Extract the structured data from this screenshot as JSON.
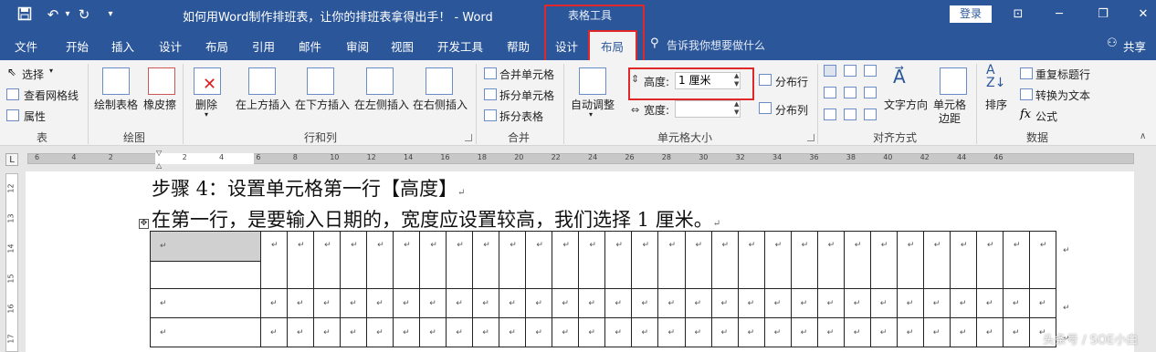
{
  "app": {
    "doc_title": "如何用Word制作排班表，让你的排班表拿得出手！ - Word",
    "context_group": "表格工具",
    "login": "登录",
    "quick_access": {
      "save": "save-icon",
      "undo": "undo-icon",
      "redo": "redo-icon",
      "customize": "▾"
    }
  },
  "tabs": [
    "文件",
    "开始",
    "插入",
    "设计",
    "布局",
    "引用",
    "邮件",
    "审阅",
    "视图",
    "开发工具",
    "帮助",
    "设计",
    "布局"
  ],
  "tell_me": "告诉我你想要做什么",
  "share": "共享",
  "ribbon": {
    "table": {
      "select": "选择",
      "gridlines": "查看网格线",
      "properties": "属性",
      "label": "表"
    },
    "draw": {
      "draw_table": "绘制表格",
      "eraser": "橡皮擦",
      "label": "绘图"
    },
    "rows_cols": {
      "delete": "删除",
      "insert_above": "在上方插入",
      "insert_below": "在下方插入",
      "insert_left": "在左侧插入",
      "insert_right": "在右侧插入",
      "label": "行和列"
    },
    "merge": {
      "merge_cells": "合并单元格",
      "split_cells": "拆分单元格",
      "split_table": "拆分表格",
      "label": "合并"
    },
    "cell_size": {
      "autofit": "自动调整",
      "height_label": "高度:",
      "height_value": "1 厘米",
      "width_label": "宽度:",
      "width_value": "",
      "distribute_rows": "分布行",
      "distribute_cols": "分布列",
      "label": "单元格大小"
    },
    "alignment": {
      "text_direction": "文字方向",
      "cell_margins_1": "单元格",
      "cell_margins_2": "边距",
      "label": "对齐方式"
    },
    "data": {
      "sort": "排序",
      "repeat_header": "重复标题行",
      "convert_text": "转换为文本",
      "formula": "公式",
      "label": "数据"
    }
  },
  "ruler": {
    "numbers": [
      "6",
      "4",
      "2",
      "",
      "2",
      "4",
      "6",
      "8",
      "10",
      "12",
      "14",
      "16",
      "18",
      "20",
      "22",
      "24",
      "26",
      "28",
      "30",
      "32",
      "34",
      "36",
      "38",
      "40",
      "42",
      "44",
      "46"
    ],
    "corner": "L"
  },
  "vruler": [
    "12",
    "13",
    "14",
    "15",
    "16",
    "17"
  ],
  "document": {
    "line1": "步骤 4：设置单元格第一行【高度】",
    "line2": "在第一行，是要输入日期的，宽度应设置较高，我们选择 1 厘米。",
    "para_mark": "↵",
    "table_rows": 3,
    "table_cols": 31
  },
  "watermark": "头条号 / SOE小白"
}
